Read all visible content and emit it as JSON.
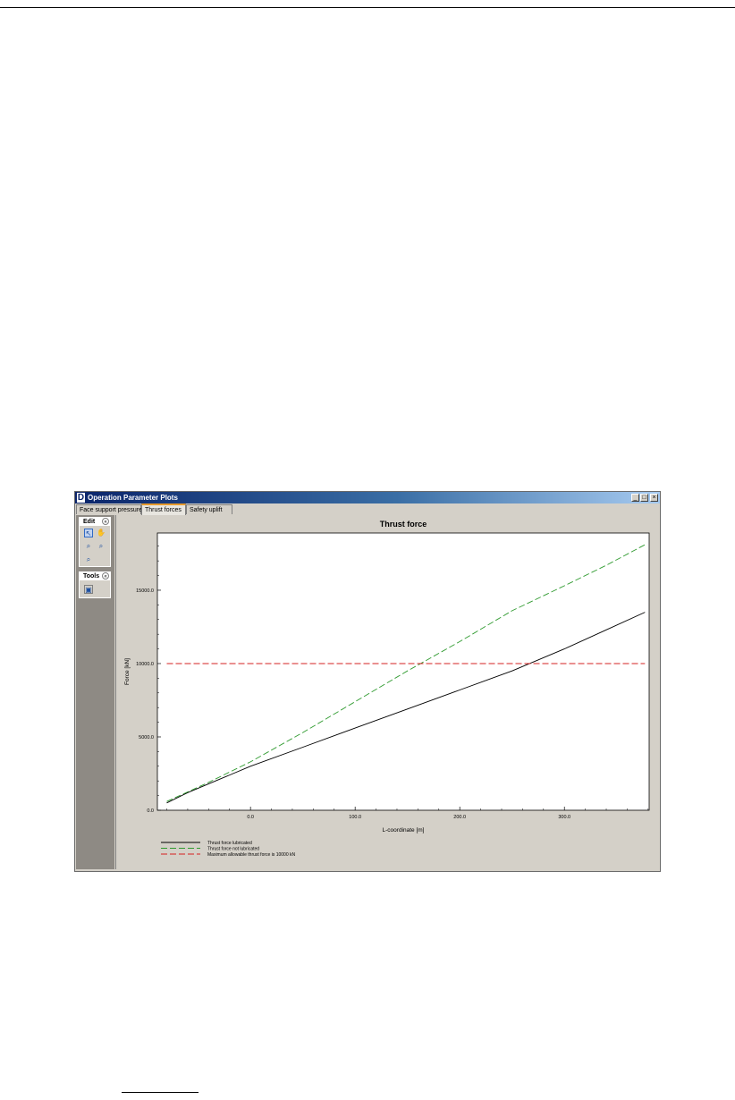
{
  "window": {
    "app_icon": "D",
    "title": "Operation Parameter Plots",
    "controls": {
      "minimize": "_",
      "maximize": "□",
      "close": "×"
    }
  },
  "tabs": [
    {
      "label": "Face support pressure",
      "active": false
    },
    {
      "label": "Thrust forces",
      "active": true
    },
    {
      "label": "Safety uplift",
      "active": false
    }
  ],
  "sidebar": {
    "edit_panel": {
      "title": "Edit",
      "toggle": "«",
      "tools": [
        "select-arrow-icon",
        "pan-hand-icon",
        "zoom-in-icon",
        "zoom-out-icon",
        "zoom-reset-icon"
      ]
    },
    "tools_panel": {
      "title": "Tools",
      "toggle": "«",
      "tools": [
        "export-icon"
      ]
    }
  },
  "chart_data": {
    "type": "line",
    "title": "Thrust force",
    "xlabel": "L-coordinate [m]",
    "ylabel": "Force [kN]",
    "xlim": [
      -89,
      381
    ],
    "ylim": [
      0,
      18900
    ],
    "xticks": [
      0,
      100,
      200,
      300
    ],
    "xtick_labels": [
      "0.0",
      "100.0",
      "200.0",
      "300.0"
    ],
    "yticks": [
      0,
      5000,
      10000,
      15000
    ],
    "ytick_labels": [
      "0.0",
      "5000.0",
      "10000.0",
      "15000.0"
    ],
    "grid": false,
    "legend": "bottom-left",
    "series": [
      {
        "name": "Thrust force lubricated",
        "color": "#000000",
        "dash": "solid",
        "x": [
          -80,
          -60,
          -30,
          0,
          50,
          100,
          150,
          200,
          250,
          300,
          340,
          377
        ],
        "y": [
          500,
          1200,
          2100,
          3000,
          4300,
          5600,
          6900,
          8200,
          9500,
          11000,
          12300,
          13500
        ]
      },
      {
        "name": "Thrust force not lubricated",
        "color": "#2e9a2e",
        "dash": "long",
        "x": [
          -80,
          -40,
          0,
          50,
          100,
          150,
          200,
          250,
          300,
          340,
          377
        ],
        "y": [
          600,
          1900,
          3300,
          5300,
          7400,
          9500,
          11500,
          13600,
          15300,
          16700,
          18100
        ]
      },
      {
        "name": "Maximum allowable thrust force is 10000 kN",
        "color": "#d62020",
        "dash": "long",
        "x": [
          -80,
          377
        ],
        "y": [
          10000,
          10000
        ]
      }
    ]
  }
}
